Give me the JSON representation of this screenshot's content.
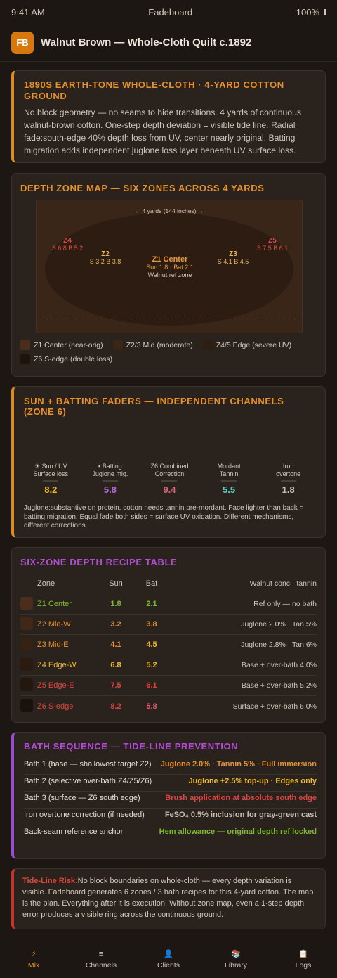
{
  "status": {
    "time": "9:41 AM",
    "app": "Fadeboard",
    "battery": "100%"
  },
  "header": {
    "logo": "FB",
    "title": "Walnut Brown — Whole-Cloth Quilt c.1892"
  },
  "intro": {
    "title": "1890s Earth-tone whole-cloth · 4-yard cotton ground",
    "body": "No block geometry — no seams to hide transitions. 4 yards of continuous walnut-brown cotton. One-step depth deviation = visible tide line. Radial fade:south-edge 40% depth loss from UV, center nearly original. Batting migration adds independent juglone loss layer beneath UV surface loss."
  },
  "map": {
    "title": "Depth Zone Map — Six Zones Across 4 Yards",
    "yards": "← 4 yards (144 inches) →",
    "zones": {
      "z4": {
        "label": "Z4",
        "values": "S 6.8 B 5.2"
      },
      "z5": {
        "label": "Z5",
        "values": "S 7.5 B 6.1"
      },
      "z2": {
        "label": "Z2",
        "values": "S 3.2 B 3.8"
      },
      "z3": {
        "label": "Z3",
        "values": "S 4.1 B 4.5"
      },
      "z1": {
        "label": "Z1 Center",
        "values": "Sun 1.8 · Bat 2.1",
        "sub": "Walnut ref zone"
      }
    },
    "legend": [
      {
        "label": "Z1 Center (near-orig)",
        "color": "#4a2e1b"
      },
      {
        "label": "Z2/3 Mid (moderate)",
        "color": "#3b2616"
      },
      {
        "label": "Z4/5 Edge (severe UV)",
        "color": "#2e1d11"
      },
      {
        "label": "Z6 S-edge (double loss)",
        "color": "#1f140c"
      }
    ]
  },
  "faders": {
    "title": "Sun + Batting faders — independent channels (zone 6)",
    "items": [
      {
        "label_line1": "☀ Sun / UV",
        "label_line2": "Surface loss",
        "value": "8.2",
        "color": "#f0b82a"
      },
      {
        "label_line1": "▪ Batting",
        "label_line2": "Juglone mig.",
        "value": "5.8",
        "color": "#b86be0"
      },
      {
        "label_line1": "Z6 Combined",
        "label_line2": "Correction",
        "value": "9.4",
        "color": "#e26078"
      },
      {
        "label_line1": "Mordant",
        "label_line2": "Tannin",
        "value": "5.5",
        "color": "#4fd1c5"
      },
      {
        "label_line1": "Iron",
        "label_line2": "overtone",
        "value": "1.8",
        "color": "#c9c0b6"
      }
    ],
    "note": "Juglone:substantive on protein, cotton needs tannin pre-mordant. Face lighter than back = batting migration. Equal fade both sides = surface UV oxidation. Different mechanisms, different corrections."
  },
  "table": {
    "title": "Six-Zone Depth Recipe Table",
    "headers": {
      "zone": "Zone",
      "sun": "Sun",
      "bat": "Bat",
      "recipe": "Walnut conc · tannin"
    },
    "rows": [
      {
        "zone": "Z1 Center",
        "sun": "1.8",
        "bat": "2.1",
        "recipe": "Ref only — no bath",
        "swatch": "#4a2e1b",
        "zone_color": "#7dba2e",
        "sun_color": "#7dba2e",
        "bat_color": "#7dba2e"
      },
      {
        "zone": "Z2 Mid-W",
        "sun": "3.2",
        "bat": "3.8",
        "recipe": "Juglone 2.0% · Tan 5%",
        "swatch": "#3f2817",
        "zone_color": "#e8902a",
        "sun_color": "#e8902a",
        "bat_color": "#e8902a"
      },
      {
        "zone": "Z3 Mid-E",
        "sun": "4.1",
        "bat": "4.5",
        "recipe": "Juglone 2.8% · Tan 6%",
        "swatch": "#362213",
        "zone_color": "#e8902a",
        "sun_color": "#e8902a",
        "bat_color": "#f0b82a"
      },
      {
        "zone": "Z4 Edge-W",
        "sun": "6.8",
        "bat": "5.2",
        "recipe": "Base + over-bath 4.0%",
        "swatch": "#2a1a0f",
        "zone_color": "#f0b82a",
        "sun_color": "#f0b82a",
        "bat_color": "#f0b82a"
      },
      {
        "zone": "Z5 Edge-E",
        "sun": "7.5",
        "bat": "6.1",
        "recipe": "Base + over-bath 5.2%",
        "swatch": "#24170d",
        "zone_color": "#e0443e",
        "sun_color": "#e0443e",
        "bat_color": "#e0443e"
      },
      {
        "zone": "Z6 S-edge",
        "sun": "8.2",
        "bat": "5.8",
        "recipe": "Surface + over-bath 6.0%",
        "swatch": "#19110a",
        "zone_color": "#e0443e",
        "sun_color": "#e0443e",
        "bat_color": "#e26078"
      }
    ]
  },
  "bath": {
    "title": "Bath sequence — tide-line prevention",
    "rows": [
      {
        "label": "Bath 1 (base — shallowest target Z2)",
        "value": "Juglone 2.0% · Tannin 5% · Full immersion",
        "color": "#e8902a"
      },
      {
        "label": "Bath 2 (selective over-bath Z4/Z5/Z6)",
        "value": "Juglone +2.5% top-up · Edges only",
        "color": "#f0b82a"
      },
      {
        "label": "Bath 3 (surface — Z6 south edge)",
        "value": "Brush application at absolute south edge",
        "color": "#e0443e"
      },
      {
        "label": "Iron overtone correction (if needed)",
        "value": "FeSO₄ 0.5% inclusion for gray-green cast",
        "color": "#c9c0b6"
      },
      {
        "label": "Back-seam reference anchor",
        "value": "Hem allowance — original depth ref locked",
        "color": "#7dba2e"
      }
    ]
  },
  "risk": {
    "label": "Tide-Line Risk:",
    "body": "No block boundaries on whole-cloth — every depth variation is visible. Fadeboard generates 6 zones / 3 bath recipes for this 4-yard cotton. The map is the plan. Everything after it is execution. Without zone map, even a 1-step depth error produces a visible ring across the continuous ground."
  },
  "nav": [
    {
      "label": "Mix",
      "icon": "⚡",
      "icon_name": "bolt-icon"
    },
    {
      "label": "Channels",
      "icon": "≡",
      "icon_name": "sliders-icon"
    },
    {
      "label": "Clients",
      "icon": "👤",
      "icon_name": "person-icon"
    },
    {
      "label": "Library",
      "icon": "📚",
      "icon_name": "books-icon"
    },
    {
      "label": "Logs",
      "icon": "📋",
      "icon_name": "clipboard-icon"
    }
  ]
}
